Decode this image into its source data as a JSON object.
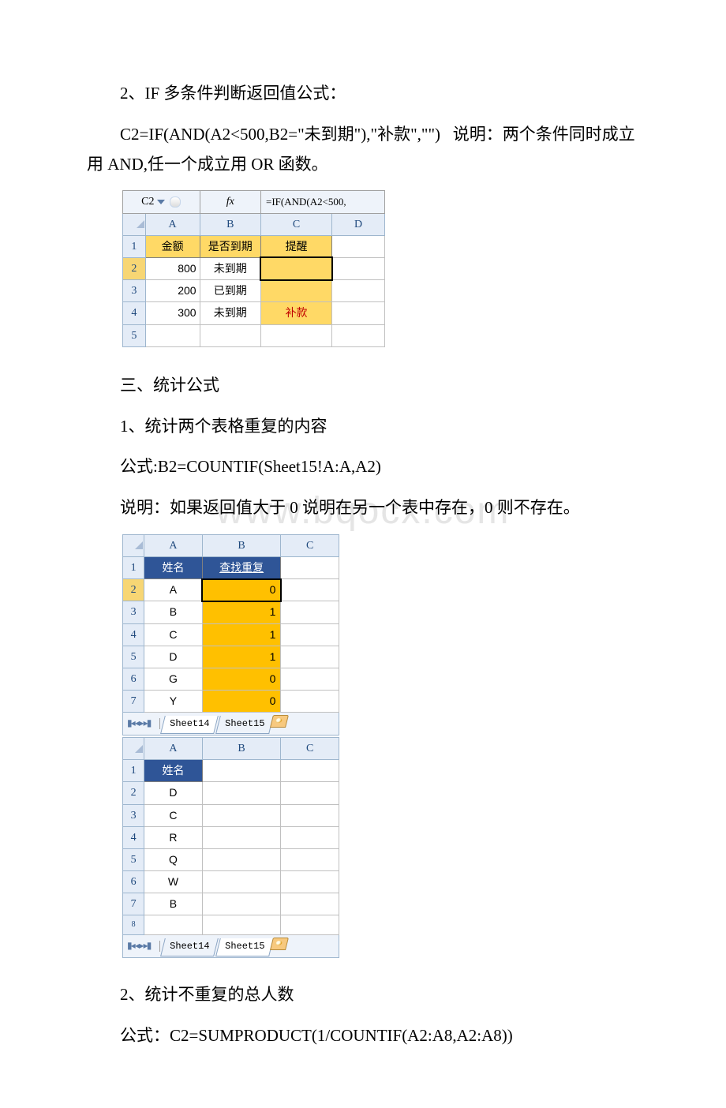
{
  "section1": {
    "title": "2、IF 多条件判断返回值公式：",
    "formula": "C2=IF(AND(A2<500,B2=\"未到期\"),\"补款\",\"\")",
    "explain_label": "说明：",
    "explain": "两个条件同时成立用 AND,任一个成立用 OR 函数。"
  },
  "excel1": {
    "cellref": "C2",
    "fx": "fx",
    "formula": "=IF(AND(A2<500,",
    "cols": [
      "A",
      "B",
      "C",
      "D"
    ],
    "headers": [
      "金额",
      "是否到期",
      "提醒"
    ],
    "rows": [
      {
        "n": "1"
      },
      {
        "n": "2",
        "a": "800",
        "b": "未到期",
        "c": ""
      },
      {
        "n": "3",
        "a": "200",
        "b": "已到期",
        "c": ""
      },
      {
        "n": "4",
        "a": "300",
        "b": "未到期",
        "c": "补款"
      },
      {
        "n": "5"
      }
    ]
  },
  "section2": {
    "heading": "三、统计公式",
    "sub1": "1、统计两个表格重复的内容",
    "formula_label": "公式:",
    "formula": "B2=COUNTIF(Sheet15!A:A,A2)",
    "explain_label": "说明：",
    "explain": "如果返回值大于 0 说明在另一个表中存在，0 则不存在。"
  },
  "watermark": "www.bqocx.com",
  "excel2a": {
    "cols": [
      "A",
      "B",
      "C"
    ],
    "header": {
      "a": "姓名",
      "b": "查找重复"
    },
    "rows": [
      {
        "n": "1"
      },
      {
        "n": "2",
        "a": "A",
        "b": "0"
      },
      {
        "n": "3",
        "a": "B",
        "b": "1"
      },
      {
        "n": "4",
        "a": "C",
        "b": "1"
      },
      {
        "n": "5",
        "a": "D",
        "b": "1"
      },
      {
        "n": "6",
        "a": "G",
        "b": "0"
      },
      {
        "n": "7",
        "a": "Y",
        "b": "0"
      }
    ],
    "tabs": [
      "Sheet14",
      "Sheet15"
    ],
    "active_tab": 0
  },
  "excel2b": {
    "cols": [
      "A",
      "B",
      "C"
    ],
    "header": {
      "a": "姓名"
    },
    "rows": [
      {
        "n": "1"
      },
      {
        "n": "2",
        "a": "D"
      },
      {
        "n": "3",
        "a": "C"
      },
      {
        "n": "4",
        "a": "R"
      },
      {
        "n": "5",
        "a": "Q"
      },
      {
        "n": "6",
        "a": "W"
      },
      {
        "n": "7",
        "a": "B"
      },
      {
        "n": "8",
        "a": ""
      }
    ],
    "tabs": [
      "Sheet14",
      "Sheet15"
    ],
    "active_tab": 1
  },
  "section3": {
    "sub": "2、统计不重复的总人数",
    "formula_label": "公式：",
    "formula": "C2=SUMPRODUCT(1/COUNTIF(A2:A8,A2:A8))"
  }
}
